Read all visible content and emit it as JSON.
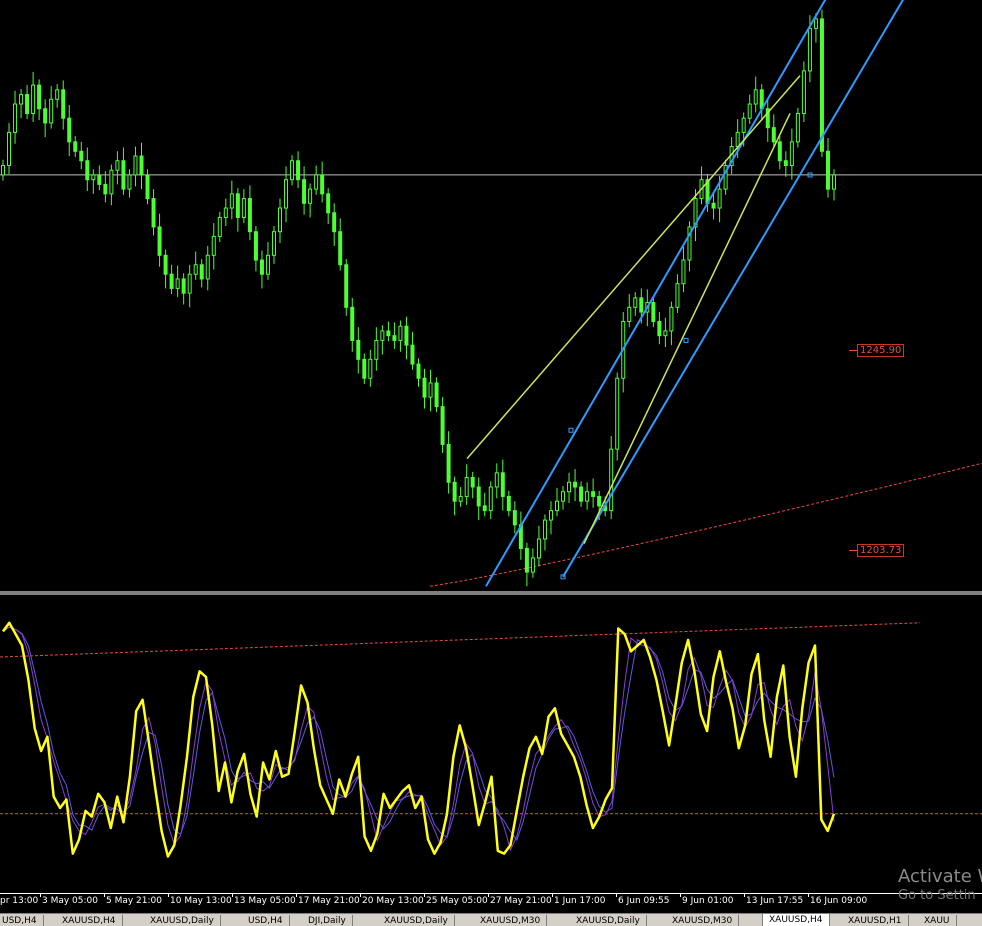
{
  "colors": {
    "background": "#000000",
    "candle": "#4cff32",
    "channel": "#2f9bff",
    "wedge": "#c8e65a",
    "level_line": "#e74c3c",
    "indicator_main": "#ffff1a",
    "indicator_signal_a": "#8a3bd6",
    "indicator_signal_b": "#5a5ae0",
    "crosshair": "#c0c0c0"
  },
  "price_tags": [
    {
      "label": "1245.90",
      "price": 1245.9
    },
    {
      "label": "1203.73",
      "price": 1203.73
    }
  ],
  "time_axis": {
    "labels": [
      "pr 13:00",
      "3 May 05:00",
      "5 May 21:00",
      "10 May 13:00",
      "13 May 05:00",
      "17 May 21:00",
      "20 May 13:00",
      "25 May 05:00",
      "27 May 21:00",
      "1 Jun 17:00",
      "6 Jun 09:55",
      "9 Jun 01:00",
      "13 Jun 17:55",
      "16 Jun 09:00"
    ]
  },
  "tabs": [
    {
      "label": "USD,H4",
      "active": false
    },
    {
      "label": "XAUUSD,H4",
      "active": false
    },
    {
      "label": "XAUUSD,Daily",
      "active": false
    },
    {
      "label": "USD,H4",
      "active": false
    },
    {
      "label": "DJI,Daily",
      "active": false
    },
    {
      "label": "XAUUSD,Daily",
      "active": false
    },
    {
      "label": "XAUUSD,M30",
      "active": false
    },
    {
      "label": "XAUUSD,Daily",
      "active": false
    },
    {
      "label": "XAUUSD,M30",
      "active": false
    },
    {
      "label": "XAUUSD,H4",
      "active": true
    },
    {
      "label": "XAUUSD,H1",
      "active": false
    },
    {
      "label": "XAUU",
      "active": false
    }
  ],
  "watermark": {
    "line1": "Activate W",
    "line2": "Go to Settin"
  },
  "chart_data": [
    {
      "type": "candlestick",
      "symbol": "XAUUSD",
      "timeframe": "H4",
      "price_range": [
        1195,
        1320
      ],
      "horizontal_level": 1283,
      "close_series": [
        1285,
        1292,
        1298,
        1300,
        1296,
        1302,
        1297,
        1294,
        1299,
        1301,
        1295,
        1290,
        1288,
        1286,
        1282,
        1283,
        1281,
        1279,
        1284,
        1286,
        1280,
        1283,
        1287,
        1283,
        1278,
        1272,
        1266,
        1262,
        1259,
        1261,
        1258,
        1262,
        1264,
        1261,
        1266,
        1270,
        1274,
        1276,
        1279,
        1274,
        1278,
        1271,
        1265,
        1262,
        1266,
        1271,
        1276,
        1282,
        1286,
        1282,
        1277,
        1280,
        1283,
        1279,
        1275,
        1271,
        1264,
        1255,
        1248,
        1244,
        1240,
        1244,
        1248,
        1250,
        1249,
        1248,
        1251,
        1247,
        1243,
        1240,
        1236,
        1239,
        1234,
        1226,
        1218,
        1214,
        1215,
        1219,
        1217,
        1213,
        1212,
        1217,
        1220,
        1215,
        1212,
        1209,
        1204,
        1199,
        1202,
        1206,
        1210,
        1212,
        1214,
        1216,
        1218,
        1217,
        1214,
        1216,
        1215,
        1213,
        1212,
        1225,
        1240,
        1252,
        1255,
        1257,
        1254,
        1256,
        1252,
        1249,
        1250,
        1255,
        1260,
        1265,
        1272,
        1278,
        1282,
        1277,
        1276,
        1280,
        1285,
        1289,
        1292,
        1295,
        1298,
        1301,
        1297,
        1293,
        1290,
        1286,
        1285,
        1290,
        1296,
        1305,
        1314,
        1316,
        1288,
        1280,
        1283
      ]
    },
    {
      "type": "line",
      "pane": "oscillator",
      "ylim": [
        0,
        100
      ],
      "reference_levels": [
        25,
        80
      ],
      "series": [
        {
          "values": [
            89,
            92,
            88,
            84,
            72,
            55,
            47,
            52,
            31,
            27,
            30,
            11,
            16,
            26,
            24,
            32,
            29,
            20,
            31,
            22,
            38,
            61,
            65,
            50,
            34,
            19,
            10,
            14,
            28,
            45,
            66,
            75,
            73,
            56,
            33,
            43,
            29,
            40,
            46,
            32,
            24,
            43,
            37,
            47,
            38,
            39,
            54,
            70,
            64,
            48,
            35,
            30,
            25,
            37,
            31,
            39,
            45,
            17,
            12,
            18,
            32,
            27,
            30,
            33,
            35,
            27,
            31,
            16,
            11,
            15,
            25,
            45,
            56,
            48,
            35,
            21,
            29,
            38,
            12,
            11,
            14,
            26,
            38,
            48,
            52,
            46,
            59,
            62,
            53,
            49,
            45,
            38,
            28,
            20,
            24,
            30,
            34,
            90,
            88,
            82,
            84,
            86,
            80,
            72,
            61,
            49,
            63,
            78,
            86,
            75,
            60,
            54,
            73,
            82,
            71,
            62,
            48,
            56,
            74,
            81,
            58,
            45,
            66,
            77,
            52,
            38,
            62,
            78,
            84,
            23,
            19,
            25
          ]
        }
      ]
    }
  ]
}
